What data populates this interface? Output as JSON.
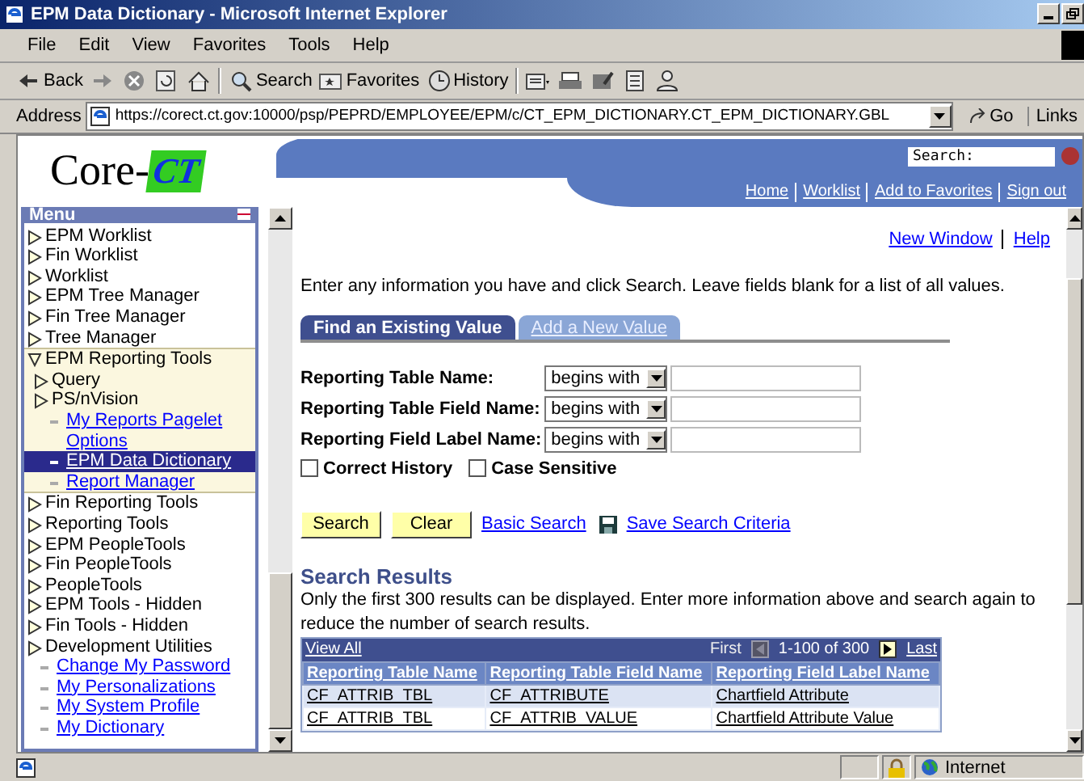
{
  "window": {
    "title": "EPM Data Dictionary - Microsoft Internet Explorer"
  },
  "menu_bar": [
    "File",
    "Edit",
    "View",
    "Favorites",
    "Tools",
    "Help"
  ],
  "toolbar": [
    {
      "kind": "back",
      "label": "Back"
    },
    {
      "kind": "forward"
    },
    {
      "kind": "stop"
    },
    {
      "kind": "refresh"
    },
    {
      "kind": "home"
    },
    {
      "kind": "search",
      "label": "Search"
    },
    {
      "kind": "favorites",
      "label": "Favorites"
    },
    {
      "kind": "history",
      "label": "History"
    },
    {
      "kind": "mail"
    },
    {
      "kind": "print"
    },
    {
      "kind": "edit"
    },
    {
      "kind": "discuss"
    },
    {
      "kind": "messenger"
    }
  ],
  "address_bar": {
    "label": "Address",
    "value": "https://corect.ct.gov:10000/psp/PEPRD/EMPLOYEE/EPM/c/CT_EPM_DICTIONARY.CT_EPM_DICTIONARY.GBL",
    "go": "Go",
    "links": "Links"
  },
  "header": {
    "logo_left": "Core-",
    "logo_right": "CT",
    "search_label": "Search:",
    "links": [
      "Home",
      "Worklist",
      "Add to Favorites",
      "Sign out"
    ]
  },
  "menu": {
    "title": "Menu",
    "items": [
      {
        "kind": "folder",
        "label": "EPM Worklist",
        "expanded": false
      },
      {
        "kind": "folder",
        "label": "Fin Worklist",
        "expanded": false
      },
      {
        "kind": "folder",
        "label": "Worklist",
        "expanded": false
      },
      {
        "kind": "folder",
        "label": "EPM Tree Manager",
        "expanded": false
      },
      {
        "kind": "folder",
        "label": "Fin Tree Manager",
        "expanded": false
      },
      {
        "kind": "folder",
        "label": "Tree Manager",
        "expanded": false
      },
      {
        "kind": "folder",
        "label": "EPM Reporting Tools",
        "expanded": true,
        "children": [
          {
            "kind": "folder",
            "label": "Query",
            "expanded": false
          },
          {
            "kind": "folder",
            "label": "PS/nVision",
            "expanded": false
          },
          {
            "kind": "link",
            "label": "My Reports Pagelet Options",
            "selected": false
          },
          {
            "kind": "link",
            "label": "EPM Data Dictionary",
            "selected": true
          },
          {
            "kind": "link",
            "label": "Report Manager",
            "selected": false
          }
        ]
      },
      {
        "kind": "folder",
        "label": "Fin Reporting Tools",
        "expanded": false
      },
      {
        "kind": "folder",
        "label": "Reporting Tools",
        "expanded": false
      },
      {
        "kind": "folder",
        "label": "EPM PeopleTools",
        "expanded": false
      },
      {
        "kind": "folder",
        "label": "Fin PeopleTools",
        "expanded": false
      },
      {
        "kind": "folder",
        "label": "PeopleTools",
        "expanded": false
      },
      {
        "kind": "folder",
        "label": "EPM Tools - Hidden",
        "expanded": false
      },
      {
        "kind": "folder",
        "label": "Fin Tools - Hidden",
        "expanded": false
      },
      {
        "kind": "folder",
        "label": "Development Utilities",
        "expanded": false
      },
      {
        "kind": "link",
        "label": "Change My Password",
        "selected": false
      },
      {
        "kind": "link",
        "label": "My Personalizations",
        "selected": false
      },
      {
        "kind": "link",
        "label": "My System Profile",
        "selected": false
      },
      {
        "kind": "link",
        "label": "My Dictionary",
        "selected": false
      }
    ]
  },
  "page_links": [
    "New Window",
    "Help"
  ],
  "instructions": "Enter any information you have and click Search. Leave fields blank for a list of all values.",
  "tabs": [
    {
      "label": "Find an Existing Value",
      "selected": true
    },
    {
      "label": "Add a New Value",
      "selected": false
    }
  ],
  "criteria": [
    {
      "label": "Reporting Table Name:",
      "operator": "begins with"
    },
    {
      "label": "Reporting Table Field Name:",
      "operator": "begins with"
    },
    {
      "label": "Reporting Field Label Name:",
      "operator": "begins with"
    }
  ],
  "checkboxes": [
    {
      "label": "Correct History",
      "checked": false
    },
    {
      "label": "Case Sensitive",
      "checked": false
    }
  ],
  "actions": {
    "buttons": [
      "Search",
      "Clear"
    ],
    "basic_search": "Basic Search",
    "save_criteria": "Save Search Criteria"
  },
  "results": {
    "title": "Search Results",
    "note": "Only the first 300 results can be displayed. Enter more information above and search again to reduce the number of search results.",
    "view_all": "View All",
    "first": "First",
    "range": "1-100 of 300",
    "last": "Last",
    "columns": [
      "Reporting Table Name",
      "Reporting Table Field Name",
      "Reporting Field Label Name"
    ],
    "rows": [
      [
        "CF_ATTRIB_TBL",
        "CF_ATTRIBUTE",
        "Chartfield Attribute"
      ],
      [
        "CF_ATTRIB_TBL",
        "CF_ATTRIB_VALUE",
        "Chartfield Attribute Value"
      ]
    ]
  },
  "status_bar": {
    "zone": "Internet"
  }
}
